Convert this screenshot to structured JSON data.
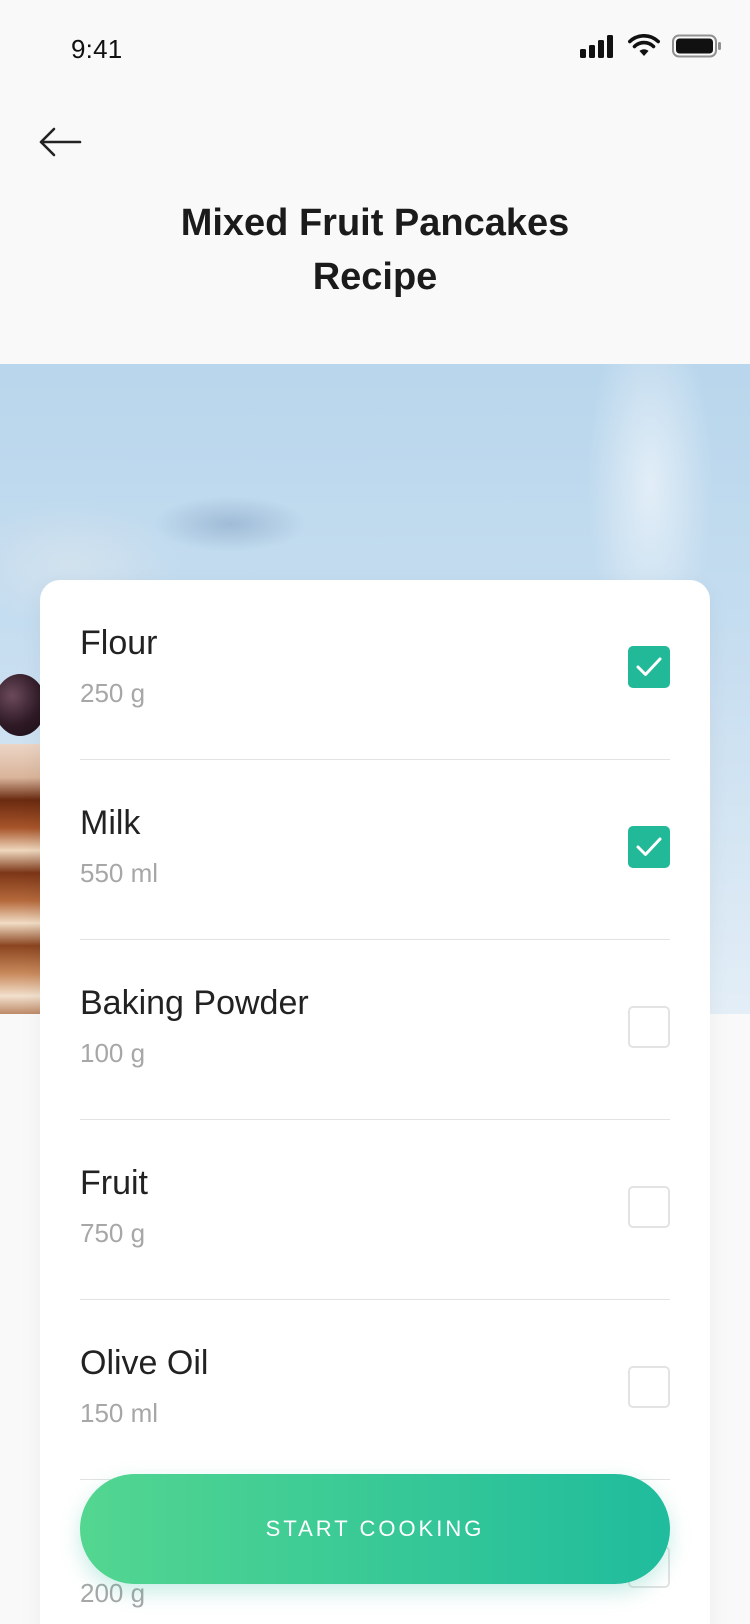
{
  "status_bar": {
    "time": "9:41",
    "icons": [
      "signal-icon",
      "wifi-icon",
      "battery-icon"
    ]
  },
  "header": {
    "back_icon": "arrow-left-icon",
    "title_line1": "Mixed Fruit Pancakes",
    "title_line2": "Recipe"
  },
  "ingredients": [
    {
      "name": "Flour",
      "quantity": "250 g",
      "checked": true
    },
    {
      "name": "Milk",
      "quantity": "550 ml",
      "checked": true
    },
    {
      "name": "Baking Powder",
      "quantity": "100 g",
      "checked": false
    },
    {
      "name": "Fruit",
      "quantity": "750 g",
      "checked": false
    },
    {
      "name": "Olive Oil",
      "quantity": "150 ml",
      "checked": false
    },
    {
      "name": "",
      "quantity": "200 g",
      "checked": false
    }
  ],
  "primary_action": {
    "label": "START COOKING"
  },
  "colors": {
    "accent": "#22b999",
    "button_gradient_start": "#53d690",
    "button_gradient_end": "#1fbc9d",
    "quantity_text": "#a7a7a7"
  }
}
